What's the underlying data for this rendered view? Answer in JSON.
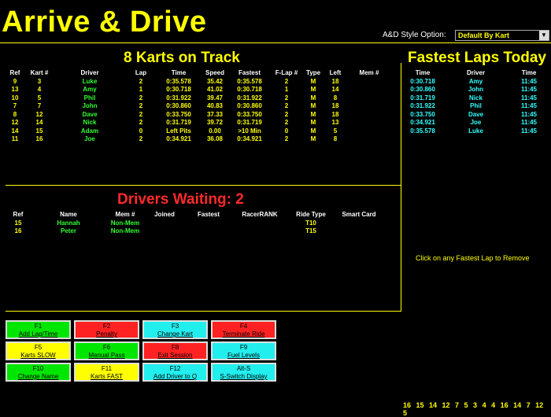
{
  "app_title": "Arrive & Drive",
  "style_option": {
    "label": "A&D Style Option:",
    "selected": "Default By Kart"
  },
  "karts": {
    "title": "8 Karts on Track",
    "headers": [
      "Ref",
      "Kart #",
      "Driver",
      "Lap",
      "Time",
      "Speed",
      "Fastest",
      "F-Lap #",
      "Type",
      "Left",
      "Mem #"
    ],
    "rows": [
      [
        "9",
        "3",
        "Luke",
        "2",
        "0:35.578",
        "35.42",
        "0:35.578",
        "2",
        "M",
        "18",
        ""
      ],
      [
        "13",
        "4",
        "Amy",
        "1",
        "0:30.718",
        "41.02",
        "0:30.718",
        "1",
        "M",
        "14",
        ""
      ],
      [
        "10",
        "5",
        "Phil",
        "2",
        "0:31.922",
        "39.47",
        "0:31.922",
        "2",
        "M",
        "8",
        ""
      ],
      [
        "7",
        "7",
        "John",
        "2",
        "0:30.860",
        "40.83",
        "0:30.860",
        "2",
        "M",
        "18",
        ""
      ],
      [
        "8",
        "12",
        "Dave",
        "2",
        "0:33.750",
        "37.33",
        "0:33.750",
        "2",
        "M",
        "18",
        ""
      ],
      [
        "12",
        "14",
        "Nick",
        "2",
        "0:31.719",
        "39.72",
        "0:31.719",
        "2",
        "M",
        "13",
        ""
      ],
      [
        "14",
        "15",
        "Adam",
        "0",
        "Left Pits",
        "0.00",
        ">10 Min",
        "0",
        "M",
        "5",
        ""
      ],
      [
        "11",
        "16",
        "Joe",
        "2",
        "0:34.921",
        "36.08",
        "0:34.921",
        "2",
        "M",
        "8",
        ""
      ]
    ]
  },
  "fastest": {
    "title": "Fastest Laps Today",
    "headers": [
      "Time",
      "Driver",
      "Time"
    ],
    "rows": [
      [
        "0:30.718",
        "Amy",
        "11:45"
      ],
      [
        "0:30.860",
        "John",
        "11:45"
      ],
      [
        "0:31.719",
        "Nick",
        "11:45"
      ],
      [
        "0:31.922",
        "Phil",
        "11:45"
      ],
      [
        "0:33.750",
        "Dave",
        "11:45"
      ],
      [
        "0:34.921",
        "Joe",
        "11:45"
      ],
      [
        "0:35.578",
        "Luke",
        "11:45"
      ]
    ],
    "hint": "Click on any Fastest Lap to Remove"
  },
  "waiting": {
    "title": "Drivers Waiting: 2",
    "headers": [
      "Ref",
      "Name",
      "Mem #",
      "Joined",
      "Fastest",
      "RacerRANK",
      "Ride Type",
      "Smart Card"
    ],
    "rows": [
      [
        "15",
        "Hannah",
        "Non-Mem",
        "",
        "",
        "",
        "T10",
        ""
      ],
      [
        "16",
        "Peter",
        "Non-Mem",
        "",
        "",
        "",
        "T15",
        ""
      ]
    ]
  },
  "function_keys": [
    {
      "key": "F1",
      "label": "Add Lap/Time",
      "color": "#00e600"
    },
    {
      "key": "F2",
      "label": "Penalty",
      "color": "#ff2222"
    },
    {
      "key": "F3",
      "label": "Change Kart",
      "color": "#22eeee"
    },
    {
      "key": "F4",
      "label": "Terminate Ride",
      "color": "#ff2222"
    },
    {
      "key": "F5",
      "label": "Karts SLOW",
      "color": "#ffff00"
    },
    {
      "key": "F6",
      "label": "Manual Pass",
      "color": "#00e600"
    },
    {
      "key": "F8",
      "label": "Exit Session",
      "color": "#ff2222"
    },
    {
      "key": "F9",
      "label": "Fuel Levels",
      "color": "#22eeee"
    },
    {
      "key": "F10",
      "label": "Change Name",
      "color": "#00e600"
    },
    {
      "key": "F11",
      "label": "Karts FAST",
      "color": "#ffff00"
    },
    {
      "key": "F12",
      "label": "Add Driver to Q",
      "color": "#22eeee"
    },
    {
      "key": "Alt-S",
      "label": "S-Switch Display",
      "color": "#22eeee"
    }
  ],
  "kart_order": "16 15 14 12 7 5 3 4 4 16 14 7 12 5"
}
